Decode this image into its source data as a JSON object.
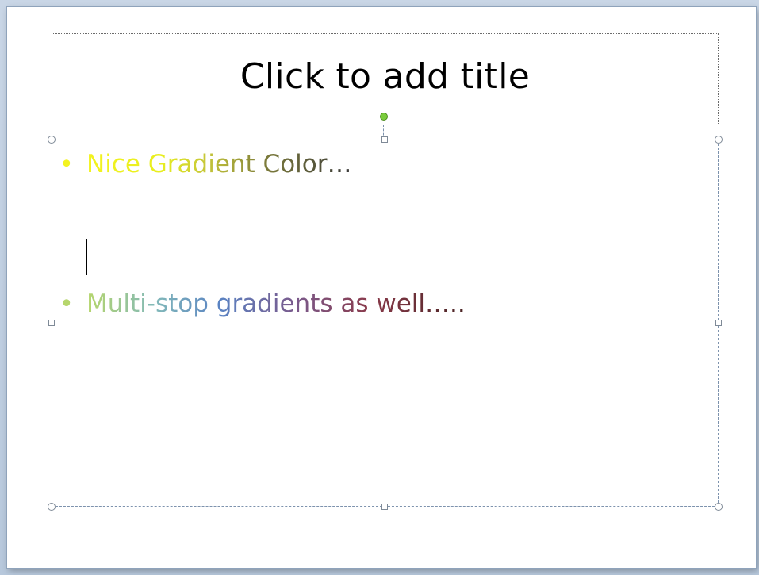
{
  "slide": {
    "title_placeholder": "Click to add title",
    "bullets": [
      {
        "text": "Nice Gradient Color…",
        "gradient": [
          "#f3f31f",
          "#c6c739",
          "#3a3a3a"
        ]
      },
      {
        "text": "Multi-stop gradients as well…..",
        "gradient": [
          "#b6d66c",
          "#5a83c3",
          "#8a3a4a",
          "#4a2424"
        ]
      }
    ],
    "bullet_glyph": "•"
  },
  "colors": {
    "selection_border": "#7d92ad",
    "rotate_handle": "#7acc3c",
    "background": "#ffffff"
  }
}
